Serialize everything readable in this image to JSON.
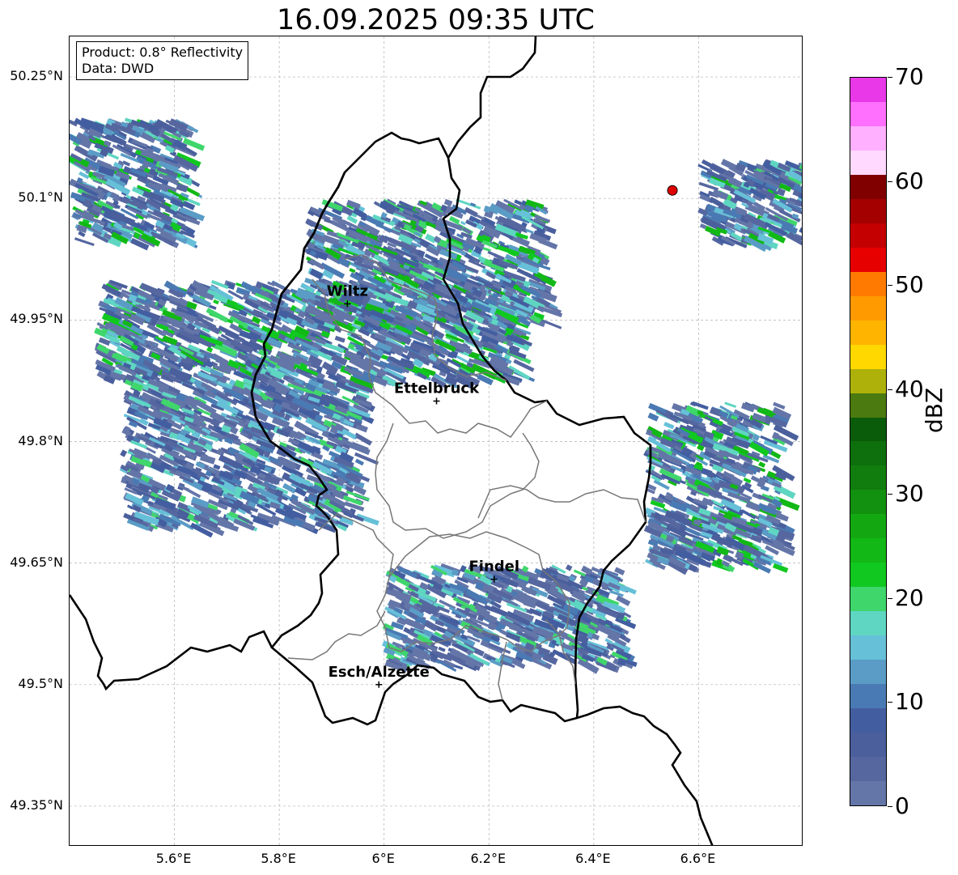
{
  "title": "16.09.2025 09:35 UTC",
  "info_box": {
    "product": "Product: 0.8° Reflectivity",
    "data": "Data: DWD"
  },
  "map": {
    "lon_range": [
      5.4,
      6.8
    ],
    "lat_range": [
      49.3,
      50.3
    ],
    "lat_ticks": [
      {
        "value": 50.25,
        "label": "50.25°N"
      },
      {
        "value": 50.1,
        "label": "50.1°N"
      },
      {
        "value": 49.95,
        "label": "49.95°N"
      },
      {
        "value": 49.8,
        "label": "49.8°N"
      },
      {
        "value": 49.65,
        "label": "49.65°N"
      },
      {
        "value": 49.5,
        "label": "49.5°N"
      },
      {
        "value": 49.35,
        "label": "49.35°N"
      }
    ],
    "lon_ticks": [
      {
        "value": 5.6,
        "label": "5.6°E"
      },
      {
        "value": 5.8,
        "label": "5.8°E"
      },
      {
        "value": 6.0,
        "label": "6°E"
      },
      {
        "value": 6.2,
        "label": "6.2°E"
      },
      {
        "value": 6.4,
        "label": "6.4°E"
      },
      {
        "value": 6.6,
        "label": "6.6°E"
      }
    ],
    "cities": [
      {
        "name": "Wiltz",
        "lon": 5.93,
        "lat": 49.97
      },
      {
        "name": "Ettelbruck",
        "lon": 6.1,
        "lat": 49.85
      },
      {
        "name": "Findel",
        "lon": 6.21,
        "lat": 49.63
      },
      {
        "name": "Esch/Alzette",
        "lon": 5.99,
        "lat": 49.5
      }
    ],
    "radar_site": {
      "lon": 6.55,
      "lat": 50.11,
      "color": "#e00000"
    },
    "echo_regions": [
      {
        "name": "northwest-band",
        "lon": [
          5.4,
          5.62
        ],
        "lat": [
          50.05,
          50.2
        ],
        "max_dbz": 25
      },
      {
        "name": "central-band",
        "lon": [
          5.45,
          6.25
        ],
        "lat": [
          49.88,
          50.0
        ],
        "max_dbz": 25
      },
      {
        "name": "north-central",
        "lon": [
          5.85,
          6.3
        ],
        "lat": [
          49.95,
          50.1
        ],
        "max_dbz": 25
      },
      {
        "name": "southwest-tail",
        "lon": [
          5.5,
          5.95
        ],
        "lat": [
          49.7,
          49.88
        ],
        "max_dbz": 20
      },
      {
        "name": "east-cluster",
        "lon": [
          6.5,
          6.75
        ],
        "lat": [
          49.65,
          49.85
        ],
        "max_dbz": 25
      },
      {
        "name": "northeast-cluster",
        "lon": [
          6.6,
          6.8
        ],
        "lat": [
          50.05,
          50.15
        ],
        "max_dbz": 25
      },
      {
        "name": "southeast-streaks",
        "lon": [
          6.0,
          6.45
        ],
        "lat": [
          49.53,
          49.65
        ],
        "max_dbz": 20
      }
    ]
  },
  "colorbar": {
    "unit": "dBZ",
    "min": 0,
    "max": 70,
    "step": 2.5,
    "ticks": [
      {
        "value": 0,
        "label": "0"
      },
      {
        "value": 10,
        "label": "10"
      },
      {
        "value": 20,
        "label": "20"
      },
      {
        "value": 30,
        "label": "30"
      },
      {
        "value": 40,
        "label": "40"
      },
      {
        "value": 50,
        "label": "50"
      },
      {
        "value": 60,
        "label": "60"
      },
      {
        "value": 70,
        "label": "70"
      }
    ],
    "colors": [
      "#6475a8",
      "#5667a0",
      "#4a5f9c",
      "#435ea0",
      "#4a7ab3",
      "#5a9cc6",
      "#66c0d8",
      "#5fd6c2",
      "#3fd66b",
      "#10c820",
      "#12b815",
      "#13a812",
      "#12900f",
      "#117d0e",
      "#0d700c",
      "#0a5c0a",
      "#4b7a10",
      "#aeb10a",
      "#ffd800",
      "#ffb400",
      "#ff9a00",
      "#ff7a00",
      "#e60000",
      "#c40000",
      "#a40000",
      "#800000",
      "#ffd9ff",
      "#ffb0ff",
      "#ff70ff",
      "#e838e8"
    ]
  }
}
